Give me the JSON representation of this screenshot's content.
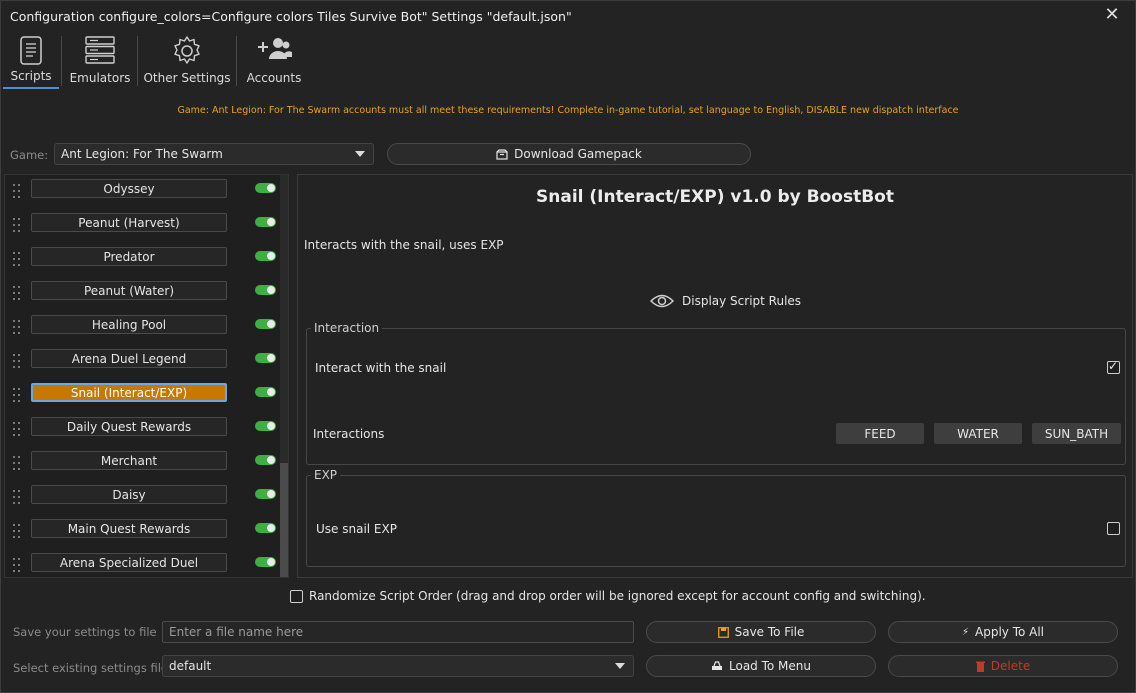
{
  "window": {
    "title": "Configuration configure_colors=Configure colors Tiles Survive Bot\" Settings \"default.json\"",
    "close_glyph": "✕"
  },
  "tabs": [
    {
      "label": "Scripts",
      "icon": "scroll-icon",
      "active": true
    },
    {
      "label": "Emulators",
      "icon": "server-icon",
      "active": false
    },
    {
      "label": "Other Settings",
      "icon": "gear-icon",
      "active": false
    },
    {
      "label": "Accounts",
      "icon": "add-users-icon",
      "active": false
    }
  ],
  "notice": "Game: Ant Legion: For The Swarm accounts must all meet these requirements! Complete in-game tutorial, set language to English, DISABLE new dispatch interface",
  "game_selector": {
    "label": "Game:",
    "value": "Ant Legion: For The Swarm"
  },
  "download_button": {
    "label": "Download Gamepack",
    "icon": "box-icon"
  },
  "scripts": [
    {
      "name": "Odyssey",
      "enabled": true,
      "selected": false
    },
    {
      "name": "Peanut (Harvest)",
      "enabled": true,
      "selected": false
    },
    {
      "name": "Predator",
      "enabled": true,
      "selected": false
    },
    {
      "name": "Peanut (Water)",
      "enabled": true,
      "selected": false
    },
    {
      "name": "Healing Pool",
      "enabled": true,
      "selected": false
    },
    {
      "name": "Arena Duel Legend",
      "enabled": true,
      "selected": false
    },
    {
      "name": "Snail (Interact/EXP)",
      "enabled": true,
      "selected": true
    },
    {
      "name": "Daily Quest Rewards",
      "enabled": true,
      "selected": false
    },
    {
      "name": "Merchant",
      "enabled": true,
      "selected": false
    },
    {
      "name": "Daisy",
      "enabled": true,
      "selected": false
    },
    {
      "name": "Main Quest Rewards",
      "enabled": true,
      "selected": false
    },
    {
      "name": "Arena Specialized Duel",
      "enabled": true,
      "selected": false
    }
  ],
  "detail": {
    "title": "Snail (Interact/EXP) v1.0 by BoostBot",
    "description": "Interacts with the snail, uses EXP",
    "rules_label": "Display Script Rules",
    "interaction_group": {
      "title": "Interaction",
      "interact_label": "Interact with the snail",
      "interact_checked": true,
      "interactions_label": "Interactions",
      "buttons": [
        "FEED",
        "WATER",
        "SUN_BATH"
      ]
    },
    "exp_group": {
      "title": "EXP",
      "use_exp_label": "Use snail EXP",
      "use_exp_checked": false
    }
  },
  "randomize": {
    "label": "Randomize Script Order (drag and drop order will be ignored except for account config and switching).",
    "checked": false
  },
  "save_row": {
    "label": "Save your settings to file",
    "placeholder": "Enter a file name here",
    "save_button": "Save To File",
    "apply_button": "Apply To All"
  },
  "load_row": {
    "label": "Select existing settings file",
    "value": "default",
    "load_button": "Load To Menu",
    "delete_button": "Delete"
  },
  "colors": {
    "accent_blue": "#4a90d9",
    "notice_orange": "#e8a317",
    "selected_script": "#c77800",
    "toggle_on": "#3cb043",
    "delete_red": "#c0392b"
  }
}
